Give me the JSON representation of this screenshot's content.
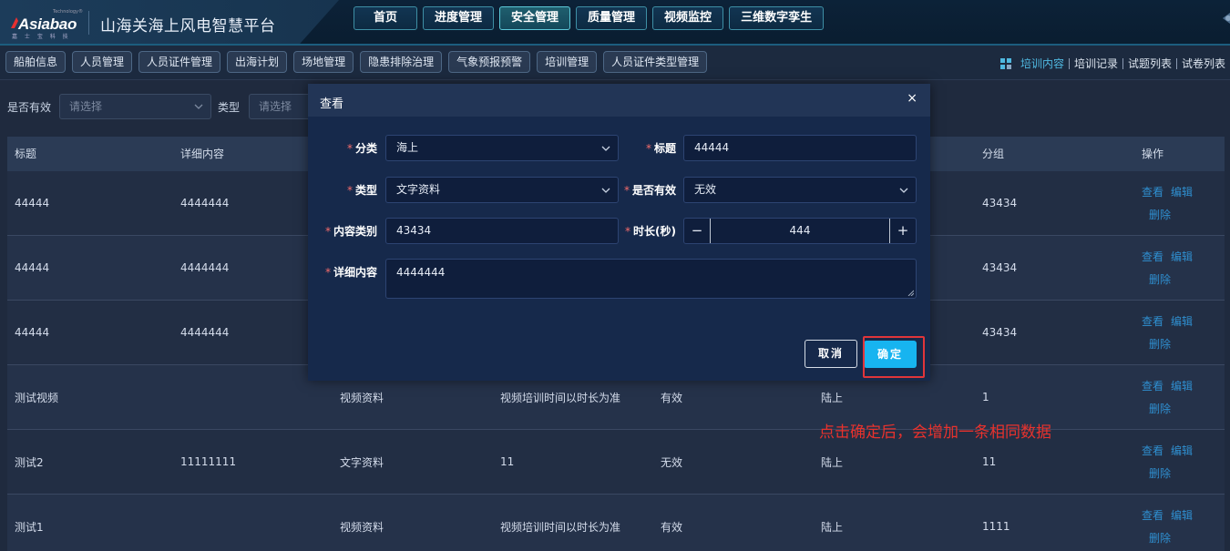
{
  "header": {
    "logo_text": "Asiabao",
    "logo_tm": "Technology®",
    "logo_sub": "嘉 士 宝 科 技",
    "app_title": "山海关海上风电智慧平台",
    "nav": [
      {
        "label": "首页",
        "active": false
      },
      {
        "label": "进度管理",
        "active": false
      },
      {
        "label": "安全管理",
        "active": true
      },
      {
        "label": "质量管理",
        "active": false
      },
      {
        "label": "视频监控",
        "active": false
      },
      {
        "label": "三维数字孪生",
        "active": false
      }
    ]
  },
  "subnav": {
    "items": [
      "船舶信息",
      "人员管理",
      "人员证件管理",
      "出海计划",
      "场地管理",
      "隐患排除治理",
      "气象预报预警",
      "培训管理",
      "人员证件类型管理"
    ],
    "right_links": [
      {
        "label": "培训内容",
        "active": true
      },
      {
        "label": "培训记录",
        "active": false
      },
      {
        "label": "试题列表",
        "active": false
      },
      {
        "label": "试卷列表",
        "active": false
      }
    ]
  },
  "filters": {
    "valid_label": "是否有效",
    "valid_placeholder": "请选择",
    "type_label": "类型",
    "type_placeholder": "请选择"
  },
  "table": {
    "columns": [
      "标题",
      "详细内容",
      "",
      "",
      "",
      "",
      "分组",
      "操作"
    ],
    "rows": [
      {
        "title": "44444",
        "detail": "4444444",
        "type": "",
        "remark": "",
        "valid": "",
        "category": "",
        "group": "43434"
      },
      {
        "title": "44444",
        "detail": "4444444",
        "type": "",
        "remark": "",
        "valid": "",
        "category": "",
        "group": "43434"
      },
      {
        "title": "44444",
        "detail": "4444444",
        "type": "",
        "remark": "",
        "valid": "",
        "category": "",
        "group": "43434"
      },
      {
        "title": "测试视频",
        "detail": "",
        "type": "视频资料",
        "remark": "视频培训时间以时长为准",
        "valid": "有效",
        "category": "陆上",
        "group": "1"
      },
      {
        "title": "测试2",
        "detail": "11111111",
        "type": "文字资料",
        "remark": "11",
        "valid": "无效",
        "category": "陆上",
        "group": "11"
      },
      {
        "title": "测试1",
        "detail": "",
        "type": "视频资料",
        "remark": "视频培训时间以时长为准",
        "valid": "有效",
        "category": "陆上",
        "group": "1111"
      }
    ],
    "ops": {
      "view": "查看",
      "edit": "编辑",
      "delete": "删除"
    }
  },
  "modal": {
    "title": "查看",
    "close": "×",
    "fields": {
      "category_label": "分类",
      "category_value": "海上",
      "title_label": "标题",
      "title_value": "44444",
      "type_label": "类型",
      "type_value": "文字资料",
      "valid_label": "是否有效",
      "valid_value": "无效",
      "content_cat_label": "内容类别",
      "content_cat_value": "43434",
      "duration_label": "时长(秒)",
      "duration_value": "444",
      "detail_label": "详细内容",
      "detail_value": "4444444"
    },
    "required_mark": "*",
    "stepper_minus": "−",
    "stepper_plus": "+",
    "cancel_label": "取消",
    "ok_label": "确定"
  },
  "annotation": "点击确定后，会增加一条相同数据",
  "colors": {
    "accent": "#17b4f0",
    "link": "#2f8fd0",
    "required": "#f56c6c",
    "annotation": "#e8322d"
  }
}
